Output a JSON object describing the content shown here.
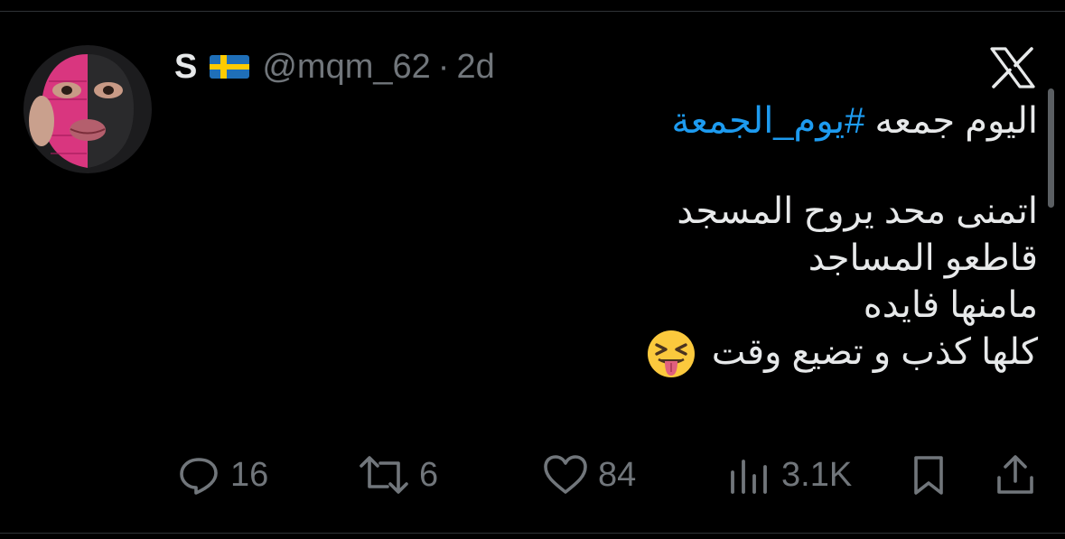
{
  "user": {
    "display_name": "S",
    "flag_icon": "sweden-flag-icon",
    "handle": "@mqm_62",
    "separator": "·",
    "time": "2d"
  },
  "tweet": {
    "line1_text": "اليوم جمعه",
    "line1_hashtag": "#يوم_الجمعة",
    "line2": "اتمنى محد يروح المسجد",
    "line3": "قاطعو المساجد",
    "line4": "مامنها فايده",
    "line5": "كلها كذب و تضيع وقت",
    "emoji": "😝",
    "link_color": "#1d9bf0"
  },
  "actions": {
    "replies": "16",
    "retweets": "6",
    "likes": "84",
    "views": "3.1K"
  },
  "colors": {
    "background": "#000000",
    "text": "#e7e9ea",
    "muted": "#71767b"
  }
}
